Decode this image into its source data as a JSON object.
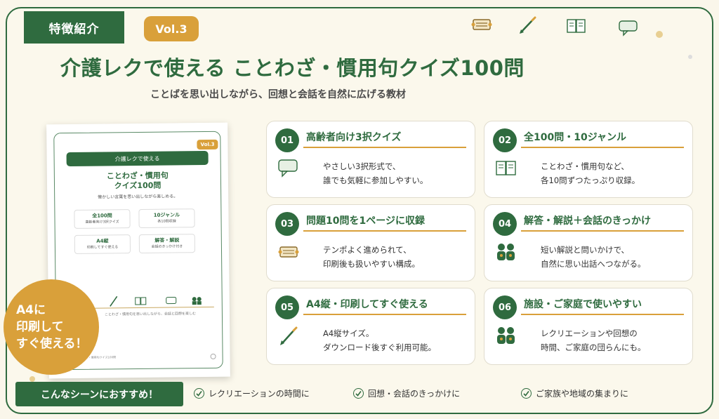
{
  "header": {
    "tag": "特徴紹介",
    "vol": "Vol.3",
    "title": "介護レクで使える ことわざ・慣用句クイズ100問",
    "subtitle": "ことばを思い出しながら、回想と会話を自然に広げる教材"
  },
  "top_icons": [
    "ticket-icon",
    "pencil-icon",
    "book-icon",
    "speech-bubble-icon"
  ],
  "doc_preview": {
    "vol": "Vol.3",
    "bar": "介護レクで使える",
    "title_line1": "ことわざ・慣用句",
    "title_line2": "クイズ100問",
    "subtitle": "懐かしい言葉を思い出しながら楽しめる。",
    "boxes": [
      {
        "main": "全100問",
        "sub": "高齢者向け3択クイズ"
      },
      {
        "main": "10ジャンル",
        "sub": "各10問収録"
      },
      {
        "main": "A4縦",
        "sub": "印刷してすぐ使える"
      },
      {
        "main": "解答・解説",
        "sub": "会話のきっかけ付き"
      }
    ],
    "footer": "ことわざ・慣用句を思い出しながら、会話と回想を楽しむ",
    "bottom": "ことわざ・慣用句クイズ100問"
  },
  "badge": {
    "line1": "A4に",
    "line2": "印刷して",
    "line3": "すぐ使える！"
  },
  "cards": [
    {
      "num": "01",
      "title": "高齢者向け3択クイズ",
      "icon": "speech-bubble-icon",
      "line1": "やさしい3択形式で、",
      "line2": "誰でも気軽に参加しやすい。"
    },
    {
      "num": "02",
      "title": "全100問・10ジャンル",
      "icon": "book-icon",
      "line1": "ことわざ・慣用句など、",
      "line2": "各10問ずつたっぷり収録。"
    },
    {
      "num": "03",
      "title": "問題10問を1ページに収録",
      "icon": "ticket-icon",
      "line1": "テンポよく進められて、",
      "line2": "印刷後も扱いやすい構成。"
    },
    {
      "num": "04",
      "title": "解答・解説＋会話のきっかけ",
      "icon": "people-icon",
      "line1": "短い解説と問いかけで、",
      "line2": "自然に思い出話へつながる。"
    },
    {
      "num": "05",
      "title": "A4縦・印刷してすぐ使える",
      "icon": "pencil-icon",
      "line1": "A4縦サイズ。",
      "line2": "ダウンロード後すぐ利用可能。"
    },
    {
      "num": "06",
      "title": "施設・ご家庭で使いやすい",
      "icon": "people-icon",
      "line1": "レクリエーションや回想の",
      "line2": "時間、ご家庭の団らんにも。"
    }
  ],
  "recommend": {
    "label": "こんなシーンにおすすめ！",
    "items": [
      "レクリエーションの時間に",
      "回想・会話のきっかけに",
      "ご家族や地域の集まりに"
    ]
  },
  "colors": {
    "primary": "#2f6b3f",
    "accent": "#d9a03a",
    "background": "#faf6ea"
  }
}
